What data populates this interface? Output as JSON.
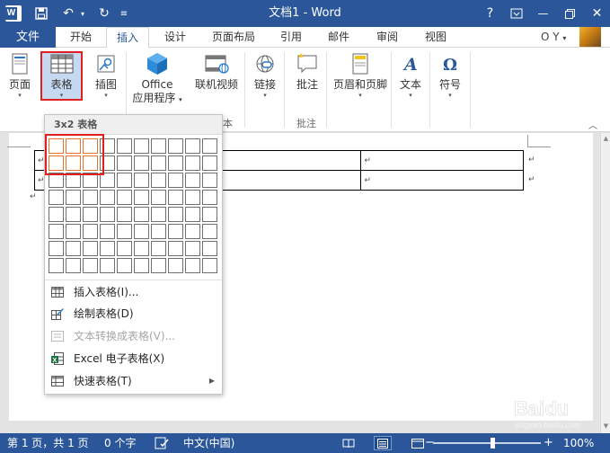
{
  "title_bar": {
    "title": "文档1 - Word",
    "help": "?",
    "minimize": "—",
    "close": "✕"
  },
  "tabs": {
    "file": "文件",
    "items": [
      "开始",
      "插入",
      "设计",
      "页面布局",
      "引用",
      "邮件",
      "审阅",
      "视图"
    ],
    "active": "插入",
    "user": "O Y"
  },
  "ribbon": {
    "page": "页面",
    "table": "表格",
    "illustration": "插图",
    "office_apps_line1": "Office",
    "office_apps_line2": "应用程序",
    "online_video": "联机视频",
    "link": "链接",
    "comment": "批注",
    "header_footer": "页眉和页脚",
    "text": "文本",
    "symbol": "符号",
    "group_media_partial": "本",
    "group_comments": "批注"
  },
  "table_dropdown": {
    "header": "3x2 表格",
    "grid_cols": 10,
    "grid_rows": 8,
    "selected_cols": 3,
    "selected_rows": 2,
    "items": [
      {
        "label": "插入表格(I)...",
        "icon": "insert-table-icon",
        "enabled": true
      },
      {
        "label": "绘制表格(D)",
        "icon": "draw-table-icon",
        "enabled": true
      },
      {
        "label": "文本转换成表格(V)...",
        "icon": "text-to-table-icon",
        "enabled": false
      },
      {
        "label": "Excel 电子表格(X)",
        "icon": "excel-icon",
        "enabled": true
      },
      {
        "label": "快速表格(T)",
        "icon": "quick-table-icon",
        "enabled": true,
        "submenu": true
      }
    ]
  },
  "document": {
    "para_mark": "↵"
  },
  "status_bar": {
    "page_info": "第 1 页，共 1 页",
    "word_count": "0 个字",
    "language": "中文(中国)",
    "zoom_minus": "−",
    "zoom_plus": "+",
    "zoom": "100%"
  },
  "watermark": {
    "brand": "Baidu",
    "sub": "jingyan.baidu.com"
  },
  "colors": {
    "word_blue": "#2b579a",
    "highlight_red": "#e02020",
    "grid_selected": "#e8732a"
  }
}
